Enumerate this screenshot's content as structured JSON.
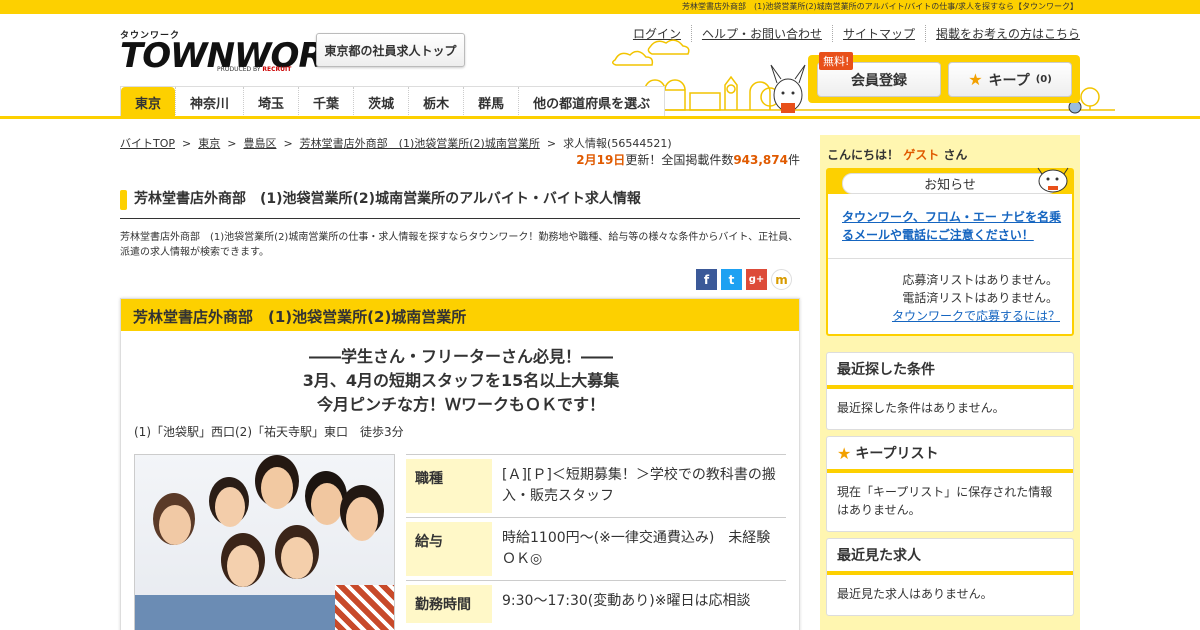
{
  "topbar": {
    "text": "芳林堂書店外商部　(1)池袋営業所(2)城南営業所のアルバイト/バイトの仕事/求人を探すなら【タウンワーク】"
  },
  "logo": {
    "small": "タウンワーク",
    "big": "TOWNWORK",
    "produced": "PRODUCED BY",
    "recruit": "RECRUIT"
  },
  "header": {
    "tokyo_button": "東京都の社員求人トップ",
    "links": [
      "ログイン",
      "ヘルプ・お問い合わせ",
      "サイトマップ",
      "掲載をお考えの方はこちら"
    ],
    "free_tag": "無料!",
    "member_button": "会員登録",
    "keep_button": "キープ",
    "keep_count": "(0)"
  },
  "tabs": [
    "東京",
    "神奈川",
    "埼玉",
    "千葉",
    "茨城",
    "栃木",
    "群馬",
    "他の都道府県を選ぶ"
  ],
  "breadcrumb": {
    "items": [
      "バイトTOP",
      "東京",
      "豊島区",
      "芳林堂書店外商部　(1)池袋営業所(2)城南営業所"
    ],
    "current": "求人情報(56544521)"
  },
  "update": {
    "date": "2月19日",
    "text": "更新！全国掲載件数",
    "count": "943,874",
    "unit": "件"
  },
  "page_heading": "芳林堂書店外商部　(1)池袋営業所(2)城南営業所のアルバイト・バイト求人情報",
  "description": "芳林堂書店外商部　(1)池袋営業所(2)城南営業所の仕事・求人情報を探すならタウンワーク！勤務地や職種、給与等の様々な条件からバイト、正社員、派遣の求人情報が検索できます。",
  "social": {
    "facebook": "f",
    "twitter": "t",
    "google": "g+",
    "mixi": "m"
  },
  "job": {
    "title": "芳林堂書店外商部　(1)池袋営業所(2)城南営業所",
    "catch": [
      "――学生さん・フリーターさん必見！――",
      "3月、4月の短期スタッフを15名以上大募集",
      "今月ピンチな方！ＷワークもＯＫです！"
    ],
    "access": "(1)「池袋駅」西口(2)「祐天寺駅」東口　徒歩3分",
    "specs": [
      {
        "label": "職種",
        "value": "[Ａ][Ｐ]＜短期募集！＞学校での教科書の搬入・販売スタッフ"
      },
      {
        "label": "給与",
        "value": "時給1100円～(※一律交通費込み)　未経験ＯＫ◎"
      },
      {
        "label": "勤務時間",
        "value": "9:30～17:30(変動あり)※曜日は応相談"
      }
    ]
  },
  "sidebar": {
    "greeting_pre": "こんにちは！",
    "guest": "ゲスト",
    "greeting_post": "さん",
    "notice_title": "お知らせ",
    "notice_link": "タウンワーク、フロム・エー ナビを名乗るメールや電話にご注意ください！",
    "applied": "応募済リストはありません。",
    "called": "電話済リストはありません。",
    "how_to_apply": "タウンワークで応募するには？",
    "recent_search_title": "最近探した条件",
    "recent_search_body": "最近探した条件はありません。",
    "keep_title": "キープリスト",
    "keep_body": "現在「キープリスト」に保存された情報はありません。",
    "recent_view_title": "最近見た求人",
    "recent_view_body": "最近見た求人はありません。"
  },
  "colors": {
    "accent": "#fdd000",
    "orange": "#e05a00",
    "link": "#1565c0"
  }
}
